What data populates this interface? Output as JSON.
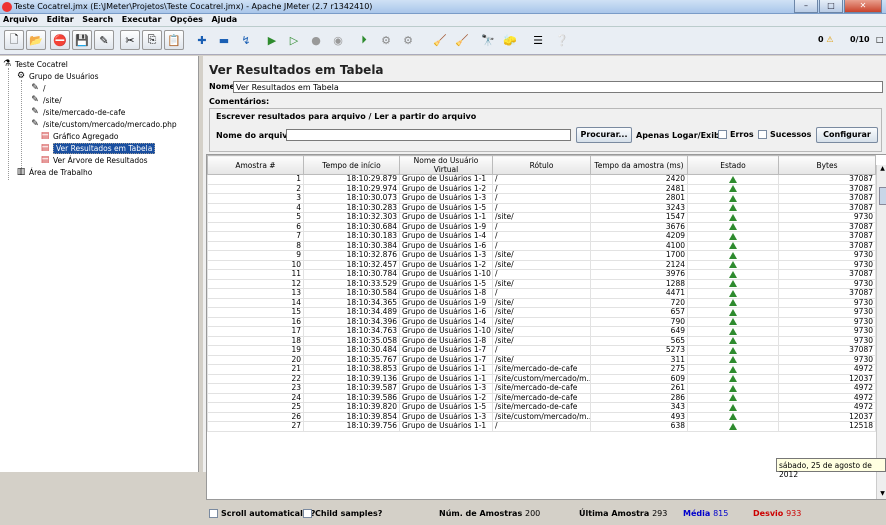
{
  "window": {
    "title": "Teste Cocatrel.jmx (E:\\JMeter\\Projetos\\Teste Cocatrel.jmx) - Apache JMeter (2.7 r1342410)",
    "min": "–",
    "max": "□",
    "close": "✕"
  },
  "menu": [
    "Arquivo",
    "Editar",
    "Search",
    "Executar",
    "Opções",
    "Ajuda"
  ],
  "toolbar": {
    "warn_count": "0",
    "threads": "0/10"
  },
  "tree": [
    {
      "label": "Teste Cocatrel",
      "icon": "flask-icon"
    },
    {
      "label": "Grupo de Usuários",
      "icon": "gear-icon"
    },
    {
      "label": "/",
      "icon": "pipette-icon"
    },
    {
      "label": "/site/",
      "icon": "pipette-icon"
    },
    {
      "label": "/site/mercado-de-cafe",
      "icon": "pipette-icon"
    },
    {
      "label": "/site/custom/mercado/mercado.php",
      "icon": "pipette-icon"
    },
    {
      "label": "Gráfico Agregado",
      "icon": "chart-icon"
    },
    {
      "label": "Ver Resultados em Tabela",
      "icon": "chart-icon"
    },
    {
      "label": "Ver Árvore de Resultados",
      "icon": "chart-icon"
    },
    {
      "label": "Área de Trabalho",
      "icon": "workbench-icon"
    }
  ],
  "panel": {
    "title": "Ver Resultados em Tabela",
    "name_label": "Nome:",
    "name_value": "Ver Resultados em Tabela",
    "comments_label": "Comentários:",
    "group_title": "Escrever resultados para arquivo / Ler a partir do arquivo",
    "file_label": "Nome do arquivo",
    "browse_button": "Procurar...",
    "only_log": "Apenas Logar/Exibir",
    "errors": "Erros",
    "successes": "Sucessos",
    "configure_button": "Configurar"
  },
  "table": {
    "headers": [
      "Amostra #",
      "Tempo de início",
      "Nome do Usuário Virtual",
      "Rótulo",
      "Tempo da amostra (ms)",
      "Estado",
      "Bytes"
    ],
    "rows": [
      [
        "1",
        "18:10:29.879",
        "Grupo de Usuários 1-1",
        "/",
        "2420",
        "37087"
      ],
      [
        "2",
        "18:10:29.974",
        "Grupo de Usuários 1-2",
        "/",
        "2481",
        "37087"
      ],
      [
        "3",
        "18:10:30.073",
        "Grupo de Usuários 1-3",
        "/",
        "2801",
        "37087"
      ],
      [
        "4",
        "18:10:30.283",
        "Grupo de Usuários 1-5",
        "/",
        "3243",
        "37087"
      ],
      [
        "5",
        "18:10:32.303",
        "Grupo de Usuários 1-1",
        "/site/",
        "1547",
        "9730"
      ],
      [
        "6",
        "18:10:30.684",
        "Grupo de Usuários 1-9",
        "/",
        "3676",
        "37087"
      ],
      [
        "7",
        "18:10:30.183",
        "Grupo de Usuários 1-4",
        "/",
        "4209",
        "37087"
      ],
      [
        "8",
        "18:10:30.384",
        "Grupo de Usuários 1-6",
        "/",
        "4100",
        "37087"
      ],
      [
        "9",
        "18:10:32.876",
        "Grupo de Usuários 1-3",
        "/site/",
        "1700",
        "9730"
      ],
      [
        "10",
        "18:10:32.457",
        "Grupo de Usuários 1-2",
        "/site/",
        "2124",
        "9730"
      ],
      [
        "11",
        "18:10:30.784",
        "Grupo de Usuários 1-10",
        "/",
        "3976",
        "37087"
      ],
      [
        "12",
        "18:10:33.529",
        "Grupo de Usuários 1-5",
        "/site/",
        "1288",
        "9730"
      ],
      [
        "13",
        "18:10:30.584",
        "Grupo de Usuários 1-8",
        "/",
        "4471",
        "37087"
      ],
      [
        "14",
        "18:10:34.365",
        "Grupo de Usuários 1-9",
        "/site/",
        "720",
        "9730"
      ],
      [
        "15",
        "18:10:34.489",
        "Grupo de Usuários 1-6",
        "/site/",
        "657",
        "9730"
      ],
      [
        "16",
        "18:10:34.396",
        "Grupo de Usuários 1-4",
        "/site/",
        "790",
        "9730"
      ],
      [
        "17",
        "18:10:34.763",
        "Grupo de Usuários 1-10",
        "/site/",
        "649",
        "9730"
      ],
      [
        "18",
        "18:10:35.058",
        "Grupo de Usuários 1-8",
        "/site/",
        "565",
        "9730"
      ],
      [
        "19",
        "18:10:30.484",
        "Grupo de Usuários 1-7",
        "/",
        "5273",
        "37087"
      ],
      [
        "20",
        "18:10:35.767",
        "Grupo de Usuários 1-7",
        "/site/",
        "311",
        "9730"
      ],
      [
        "21",
        "18:10:38.853",
        "Grupo de Usuários 1-1",
        "/site/mercado-de-cafe",
        "275",
        "4972"
      ],
      [
        "22",
        "18:10:39.136",
        "Grupo de Usuários 1-1",
        "/site/custom/mercado/m...",
        "609",
        "12037"
      ],
      [
        "23",
        "18:10:39.587",
        "Grupo de Usuários 1-3",
        "/site/mercado-de-cafe",
        "261",
        "4972"
      ],
      [
        "24",
        "18:10:39.586",
        "Grupo de Usuários 1-2",
        "/site/mercado-de-cafe",
        "286",
        "4972"
      ],
      [
        "25",
        "18:10:39.820",
        "Grupo de Usuários 1-5",
        "/site/mercado-de-cafe",
        "343",
        "4972"
      ],
      [
        "26",
        "18:10:39.854",
        "Grupo de Usuários 1-3",
        "/site/custom/mercado/m...",
        "493",
        "12037"
      ],
      [
        "27",
        "18:10:39.756",
        "Grupo de Usuários 1-1",
        "/",
        "638",
        "12518"
      ]
    ]
  },
  "footer": {
    "scroll_auto": "Scroll automatically?",
    "child_samples": "Child samples?",
    "num_label": "Núm. de Amostras",
    "num_value": "200",
    "last_label": "Última Amostra",
    "last_value": "293",
    "avg_label": "Média",
    "avg_value": "815",
    "dev_label": "Desvio",
    "dev_value": "933"
  },
  "tray": {
    "date": "sábado, 25 de agosto de 2012"
  },
  "colors": {
    "selected": "#1a4fa0",
    "avg": "#0000cc",
    "dev": "#cc0000",
    "ok": "#2e8b2e"
  }
}
